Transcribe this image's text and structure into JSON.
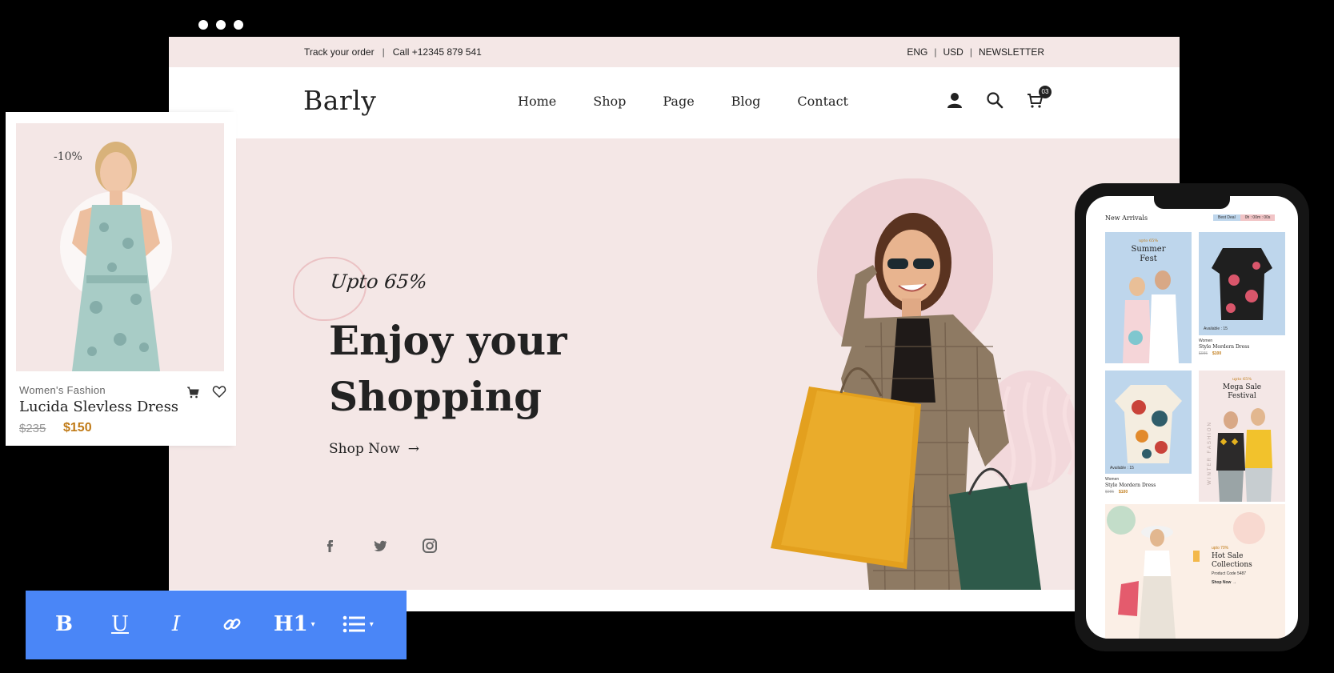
{
  "window": {
    "dots": 3
  },
  "topbar": {
    "track_order": "Track your order",
    "separator": "|",
    "call": "Call +12345 879 541",
    "lang": "ENG",
    "currency": "USD",
    "newsletter": "NEWSLETTER"
  },
  "navbar": {
    "logo": "Barly",
    "menu": [
      "Home",
      "Shop",
      "Page",
      "Blog",
      "Contact"
    ],
    "cart_count": "03",
    "icons": [
      "user-icon",
      "search-icon",
      "cart-icon"
    ]
  },
  "hero": {
    "promo": "Upto 65%",
    "title_line1": "Enjoy your",
    "title_line2": "Shopping",
    "cta": "Shop Now",
    "cta_arrow": "→",
    "socials": [
      "facebook-icon",
      "twitter-icon",
      "instagram-icon"
    ]
  },
  "product_card": {
    "discount": "-10%",
    "category": "Women's Fashion",
    "title": "Lucida Slevless Dress",
    "old_price": "$235",
    "new_price": "$150"
  },
  "toolbar": {
    "bold": "B",
    "underline": "U",
    "italic": "I",
    "heading": "H1",
    "caret": "▾",
    "icons": [
      "bold-icon",
      "underline-icon",
      "italic-icon",
      "link-icon",
      "heading-icon",
      "list-icon"
    ]
  },
  "phone": {
    "section_title": "New Arrivals",
    "deal_label": "Best Deal",
    "deal_timer": "0h : 00m : 00s",
    "tile1": {
      "promo": "upto 65%",
      "title_line1": "Summer",
      "title_line2": "Fest"
    },
    "tile2": {
      "available": "Available : 15",
      "category": "Women",
      "name": "Style Mordern Dress",
      "old_price": "$985",
      "new_price": "$100"
    },
    "tile3": {
      "available": "Available : 15",
      "category": "Women",
      "name": "Style Mordern Dress",
      "old_price": "$985",
      "new_price": "$100"
    },
    "tile4": {
      "promo": "upto 65%",
      "title_line1": "Mega Sale",
      "title_line2": "Festival",
      "side_text": "WINTER FASHION"
    },
    "banner": {
      "promo": "upto 70%",
      "title_line1": "Hot Sale",
      "title_line2": "Collections",
      "code": "Product Code 5487",
      "cta": "Shop Now →"
    }
  },
  "colors": {
    "hero_bg": "#f4e7e6",
    "accent_price": "#c07a16",
    "toolbar_bg": "#4a86f7",
    "phone_tile_blue": "#bed6ec"
  }
}
